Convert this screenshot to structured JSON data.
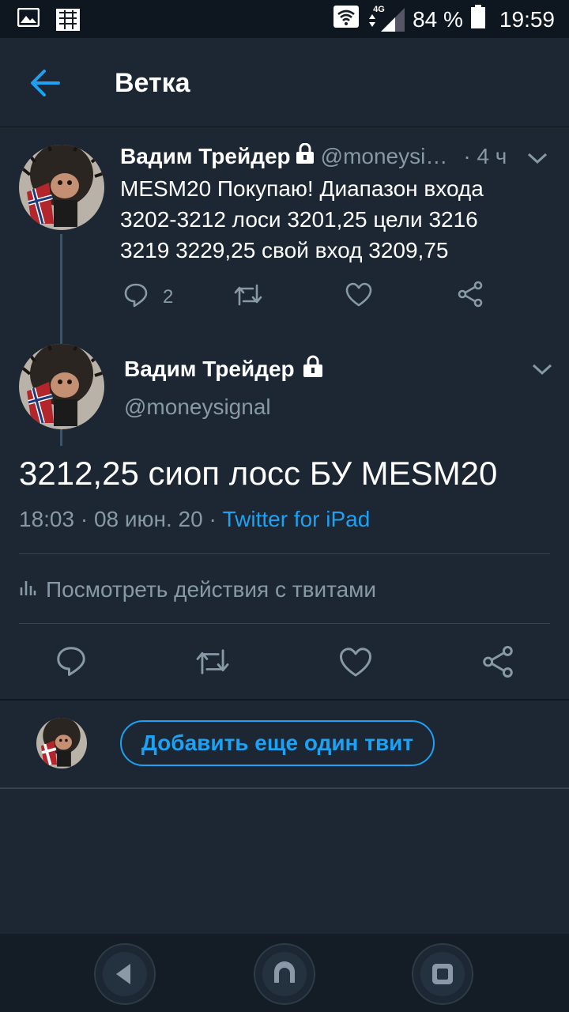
{
  "status_bar": {
    "network_type": "4G",
    "battery": "84 %",
    "time": "19:59"
  },
  "header": {
    "title": "Ветка"
  },
  "tweet_parent": {
    "name": "Вадим Трейдер",
    "handle": "@moneysi…",
    "time": "· 4 ч",
    "text": "MESM20 Покупаю! Диапазон входа 3202-3212 лоси 3201,25 цели 3216 3219 3229,25 свой вход 3209,75",
    "reply_count": "2"
  },
  "tweet_main": {
    "name": "Вадим Трейдер",
    "handle": "@moneysignal",
    "text": "3212,25 сиоп лосс БУ MESM20",
    "datetime": "18:03 · 08 июн. 20 · ",
    "source": "Twitter for iPad",
    "analytics_label": "Посмотреть действия с твитами"
  },
  "composer": {
    "add_tweet_label": "Добавить еще один твит"
  },
  "colors": {
    "accent": "#1da1f2",
    "background": "#1c2733",
    "muted_text": "#8899a6"
  }
}
